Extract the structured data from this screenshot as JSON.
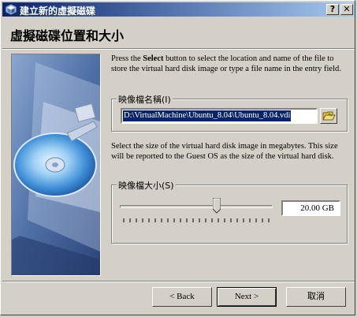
{
  "window": {
    "title": "建立新的虛擬磁碟",
    "help_label": "?",
    "close_label": "✕"
  },
  "header": {
    "title": "虛擬磁碟位置和大小"
  },
  "instructions": {
    "location_pre": "Press the ",
    "location_bold": "Select",
    "location_post": " button to select the location and name of the file to store the virtual hard disk image or type a file name in the entry field.",
    "size_text": "Select the size of the virtual hard disk image in megabytes. This size will be reported to the Guest OS as the size of the virtual hard disk."
  },
  "file_group": {
    "legend": "映像檔名稱(I)",
    "value": "D:\\VirtualMachine\\Ubuntu_8.04\\Ubuntu_8.04.vdi",
    "select_icon": "folder-open-icon"
  },
  "size_group": {
    "legend": "映像檔大小(S)",
    "value": "20.00 GB",
    "slider_fraction": 0.64,
    "tick_count": 24
  },
  "buttons": {
    "back": "< Back",
    "next": "Next >",
    "cancel": "取消"
  }
}
